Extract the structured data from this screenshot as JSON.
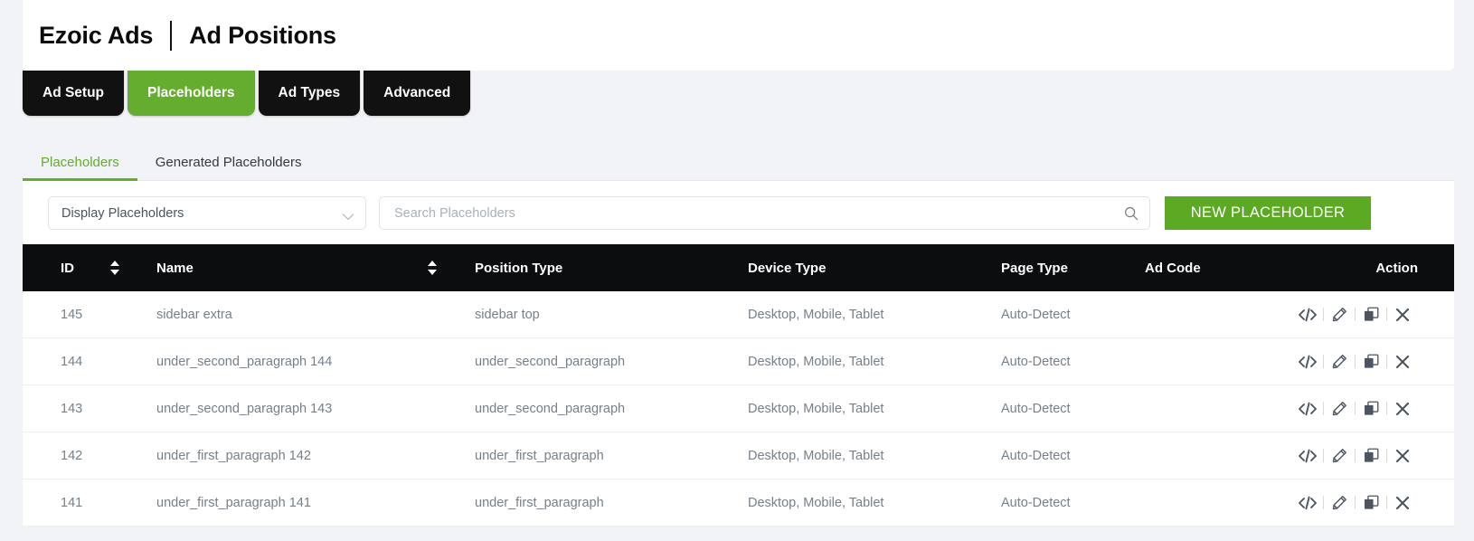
{
  "header": {
    "app_title": "Ezoic Ads",
    "page_title": "Ad Positions"
  },
  "pill_nav": {
    "items": [
      {
        "label": "Ad Setup",
        "active": false
      },
      {
        "label": "Placeholders",
        "active": true
      },
      {
        "label": "Ad Types",
        "active": false
      },
      {
        "label": "Advanced",
        "active": false
      }
    ]
  },
  "subtabs": {
    "items": [
      {
        "label": "Placeholders",
        "active": true
      },
      {
        "label": "Generated Placeholders",
        "active": false
      }
    ]
  },
  "toolbar": {
    "filter_select_value": "Display Placeholders",
    "search_placeholder": "Search Placeholders",
    "search_value": "",
    "new_placeholder_label": "NEW PLACEHOLDER",
    "accent_color": "#5ca924"
  },
  "table": {
    "columns": {
      "id": "ID",
      "name": "Name",
      "position_type": "Position Type",
      "device_type": "Device Type",
      "page_type": "Page Type",
      "ad_code": "Ad Code",
      "action": "Action"
    },
    "rows": [
      {
        "id": "145",
        "name": "sidebar extra",
        "position_type": "sidebar top",
        "device_type": "Desktop, Mobile, Tablet",
        "page_type": "Auto-Detect",
        "ad_code": ""
      },
      {
        "id": "144",
        "name": "under_second_paragraph 144",
        "position_type": "under_second_paragraph",
        "device_type": "Desktop, Mobile, Tablet",
        "page_type": "Auto-Detect",
        "ad_code": ""
      },
      {
        "id": "143",
        "name": "under_second_paragraph 143",
        "position_type": "under_second_paragraph",
        "device_type": "Desktop, Mobile, Tablet",
        "page_type": "Auto-Detect",
        "ad_code": ""
      },
      {
        "id": "142",
        "name": "under_first_paragraph 142",
        "position_type": "under_first_paragraph",
        "device_type": "Desktop, Mobile, Tablet",
        "page_type": "Auto-Detect",
        "ad_code": ""
      },
      {
        "id": "141",
        "name": "under_first_paragraph 141",
        "position_type": "under_first_paragraph",
        "device_type": "Desktop, Mobile, Tablet",
        "page_type": "Auto-Detect",
        "ad_code": ""
      }
    ],
    "row_action_icons": [
      "embed-code-icon",
      "edit-pencil-icon",
      "duplicate-icon",
      "delete-x-icon"
    ]
  }
}
